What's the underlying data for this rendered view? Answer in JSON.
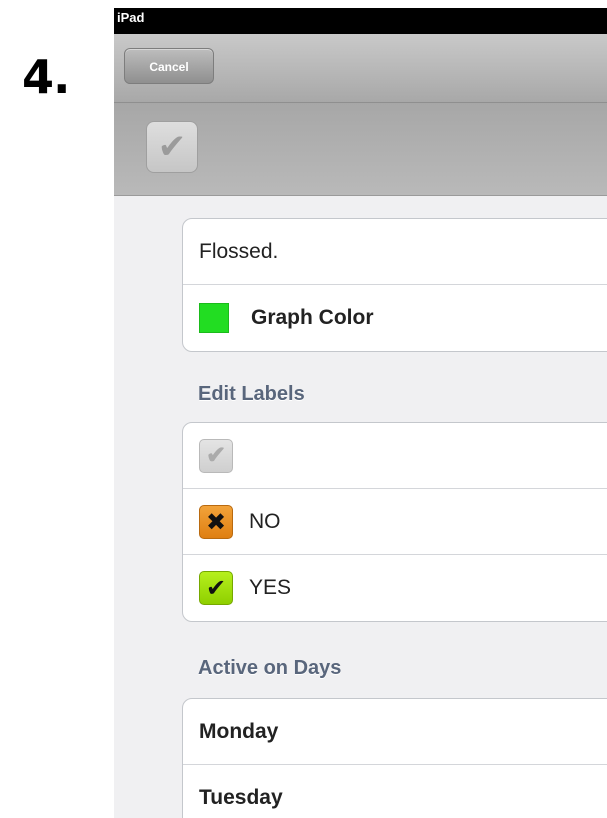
{
  "step": {
    "number": "4."
  },
  "status_bar": {
    "device": "iPad"
  },
  "nav_bar": {
    "cancel_label": "Cancel"
  },
  "toolbar": {
    "done_icon": "checkmark-icon"
  },
  "habit": {
    "name": "Flossed.",
    "graph_color_label": "Graph Color",
    "graph_color": "#22dd22"
  },
  "edit_labels": {
    "header": "Edit Labels",
    "items": [
      {
        "icon": "gray-check-icon",
        "text": ""
      },
      {
        "icon": "orange-x-icon",
        "text": "NO"
      },
      {
        "icon": "green-check-icon",
        "text": "YES"
      }
    ]
  },
  "active_days": {
    "header": "Active on Days",
    "days": [
      "Monday",
      "Tuesday"
    ]
  },
  "colors": {
    "accent_green": "#22dd22",
    "no_orange": "#e8901f",
    "yes_green": "#9fdf0c",
    "section_header": "#59667c"
  }
}
